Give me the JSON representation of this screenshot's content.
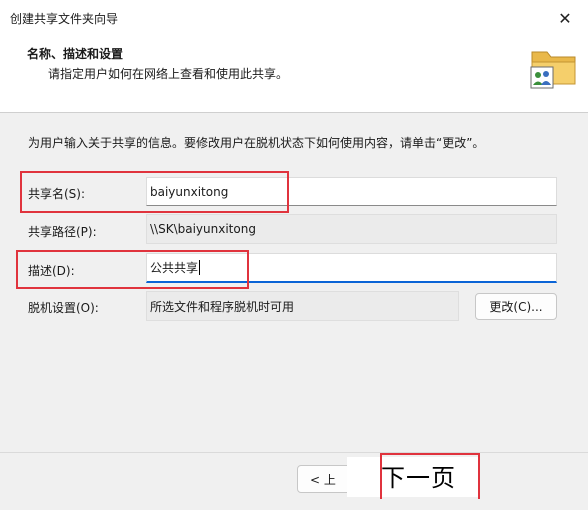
{
  "window": {
    "title": "创建共享文件夹向导",
    "close_icon": "close-icon"
  },
  "header": {
    "title": "名称、描述和设置",
    "subtitle": "请指定用户如何在网络上查看和使用此共享。",
    "icon": "shared-folder-icon"
  },
  "intro": "为用户输入关于共享的信息。要修改用户在脱机状态下如何使用内容，请单击“更改”。",
  "fields": {
    "share_name": {
      "label": "共享名(S):",
      "value": "baiyunxitong"
    },
    "share_path": {
      "label": "共享路径(P):",
      "value": "\\\\SK\\baiyunxitong"
    },
    "description": {
      "label": "描述(D):",
      "value": "公共共享"
    },
    "offline": {
      "label": "脱机设置(O):",
      "value": "所选文件和程序脱机时可用"
    }
  },
  "buttons": {
    "change": "更改(C)...",
    "back": "< 上",
    "next": "下一页"
  },
  "colors": {
    "highlight": "#e0333d",
    "focus": "#0a64d6"
  }
}
